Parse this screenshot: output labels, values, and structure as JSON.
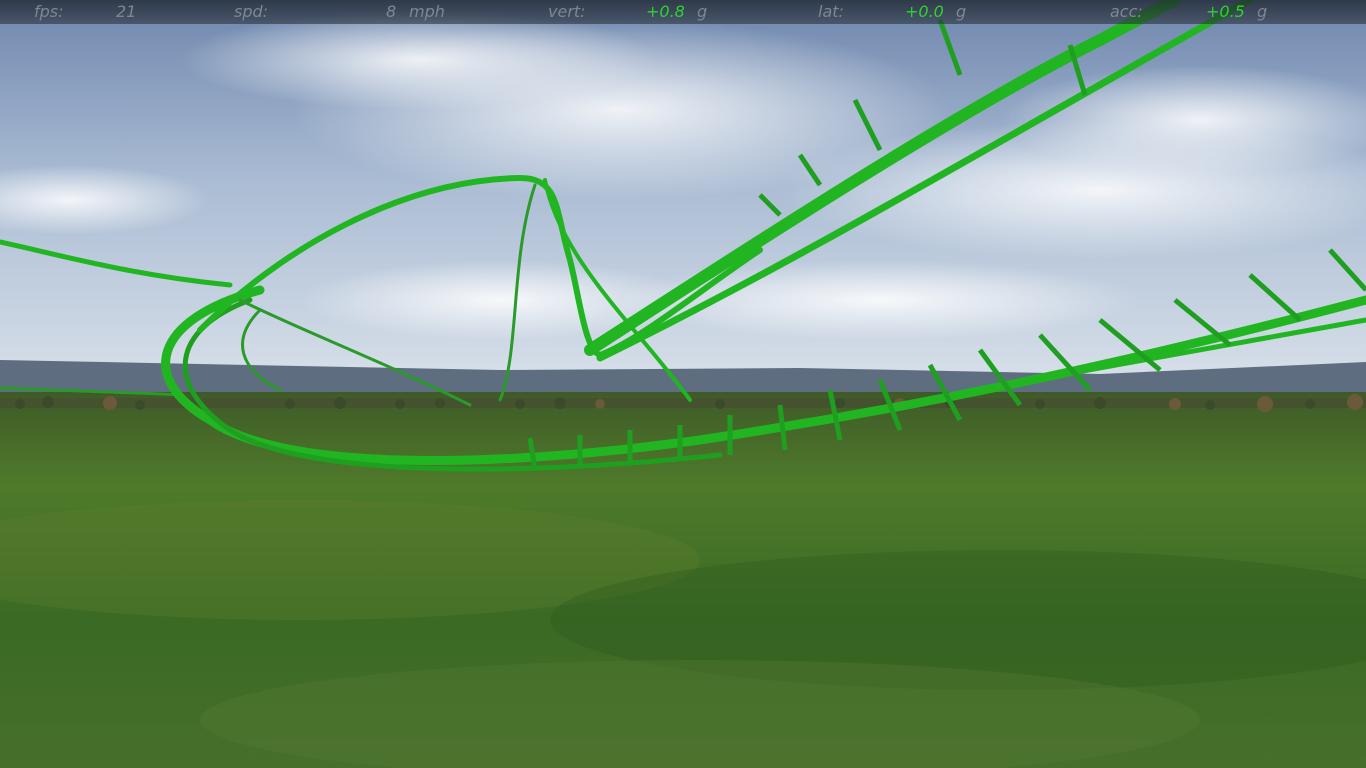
{
  "hud": {
    "fps": {
      "label": "fps:",
      "value": "21"
    },
    "speed": {
      "label": "spd:",
      "value": "8",
      "unit": "mph"
    },
    "vertical": {
      "label": "vert:",
      "value": "+0.8",
      "unit": "g"
    },
    "lateral": {
      "label": "lat:",
      "value": "+0.0",
      "unit": "g"
    },
    "acceleration": {
      "label": "acc:",
      "value": "+0.5",
      "unit": "g"
    }
  },
  "scene": {
    "track_color": "#22b522",
    "sky_color": "#9fb3cf",
    "ground_color": "#4f7a2a",
    "hud_value_color": "#2fd12f"
  }
}
